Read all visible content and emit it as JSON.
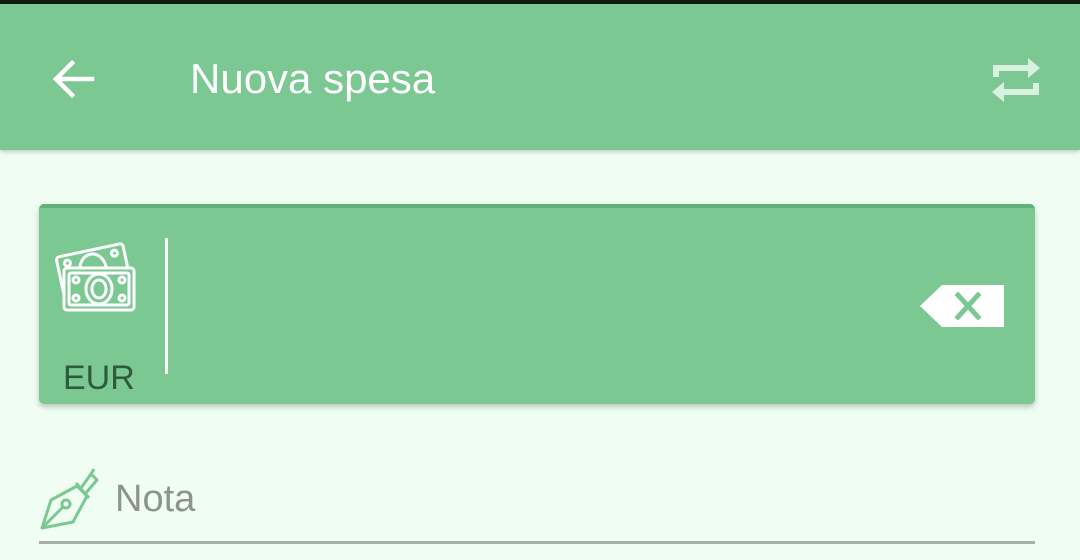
{
  "app_bar": {
    "title": "Nuova spesa",
    "back_icon": "arrow-back-icon",
    "action_icon": "repeat-icon"
  },
  "amount_card": {
    "currency_code": "EUR",
    "currency_icon": "banknotes-icon",
    "amount_value": "",
    "clear_icon": "backspace-icon"
  },
  "note_field": {
    "placeholder": "Nota",
    "value": "",
    "icon": "fountain-pen-icon"
  },
  "colors": {
    "primary": "#7bc893",
    "primary_dark": "#5fb27a",
    "background": "#effdf3",
    "currency_text": "#2f5a3c",
    "hint_text": "#8b958e",
    "underline": "#a8b0aa"
  }
}
